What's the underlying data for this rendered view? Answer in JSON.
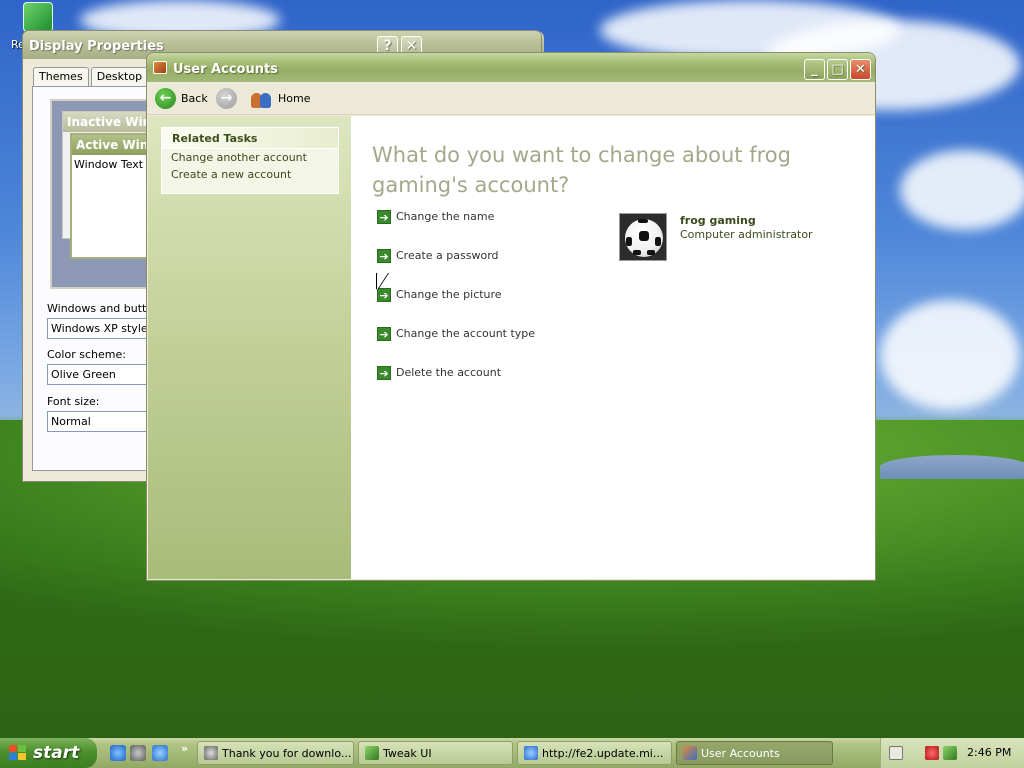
{
  "desktop": {
    "recycle_bin_label": "Re"
  },
  "display_properties": {
    "title": "Display Properties",
    "help_btn": "?",
    "close_btn": "✕",
    "tabs": [
      "Themes",
      "Desktop",
      "S"
    ],
    "preview": {
      "inactive_title": "Inactive Wind",
      "active_title": "Active Wind",
      "window_text": "Window Text"
    },
    "windows_buttons_label": "Windows and buttons:",
    "windows_buttons_value": "Windows XP style",
    "color_scheme_label": "Color scheme:",
    "color_scheme_value": "Olive Green",
    "font_size_label": "Font size:",
    "font_size_value": "Normal"
  },
  "user_accounts": {
    "title": "User Accounts",
    "toolbar": {
      "back": "Back",
      "home": "Home"
    },
    "related_tasks": {
      "header": "Related Tasks",
      "items": [
        "Change another account",
        "Create a new account"
      ]
    },
    "heading": "What do you want to change about frog gaming's account?",
    "actions": [
      "Change the name",
      "Create a password",
      "Change the picture",
      "Change the account type",
      "Delete the account"
    ],
    "account": {
      "name": "frog gaming",
      "type": "Computer administrator",
      "picture_icon": "soccer-ball-icon"
    }
  },
  "taskbar": {
    "start_label": "start",
    "quick_launch_chevron": "»",
    "tasks": [
      {
        "label": "Thank you for downlo...",
        "active": false
      },
      {
        "label": "Tweak UI",
        "active": false
      },
      {
        "label": "http://fe2.update.mi...",
        "active": false
      },
      {
        "label": "User Accounts",
        "active": true
      }
    ],
    "clock": "2:46 PM"
  },
  "colors": {
    "theme_olive": "#97ad66",
    "heading_gray": "#a4a88b",
    "action_arrow_green": "#3a8a2c",
    "start_green": "#4c8f2c"
  }
}
